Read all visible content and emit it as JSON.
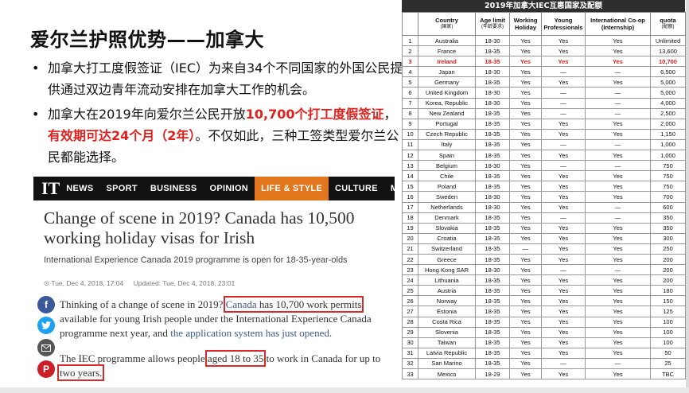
{
  "slide": {
    "title": "爱尔兰护照优势——加拿大",
    "bullet1": "加拿大打工度假签证（IEC）为来自34个不同国家的外国公民提供通过双边青年流动安排在加拿大工作的机会。",
    "bullet2_a": "加拿大在2019年向爱尔兰公民开放",
    "bullet2_b": "10,700个打工度假签证",
    "bullet2_c": "，",
    "bullet2_d": "有效期可达24个月（2年）",
    "bullet2_e": "。不仅如此，三种工签类型爱尔兰公民都能选择。"
  },
  "article": {
    "logo": "IT",
    "nav": [
      "NEWS",
      "SPORT",
      "BUSINESS",
      "OPINION",
      "LIFE & STYLE",
      "CULTURE",
      "MORE"
    ],
    "active_nav": "LIFE & STYLE",
    "headline": "Change of scene in 2019? Canada has 10,500 working holiday visas for Irish",
    "standfirst": "International Experience Canada 2019 programme is open for 18-35-year-olds",
    "date1": "⊙ Tue, Dec 4, 2018, 17:04",
    "date2": "Updated: Tue, Dec 4, 2018, 23:01",
    "p1_a": "Thinking of a change of scene in 2019? ",
    "p1_link": "Canada",
    "p1_b": " has 10,700 work permits",
    "p1_c": " available for young Irish people under the International Experience Canada programme next year, and ",
    "p1_link2": "the application system has just opened",
    "p1_d": ".",
    "p2_a": "The IEC programme allows people ",
    "p2_hl": "aged 18 to 35",
    "p2_b": " to work in Canada for up to ",
    "p2_hl2": "two years.",
    "social_icons": [
      "facebook-icon",
      "twitter-icon",
      "email-icon",
      "pinterest-icon"
    ]
  },
  "table": {
    "title": "2019年加拿大IEC互惠国家及配额",
    "headers": [
      {
        "main": "",
        "sub": ""
      },
      {
        "main": "Country",
        "sub": "(国家)"
      },
      {
        "main": "Age limit",
        "sub": "(年龄要求)"
      },
      {
        "main": "Working Holiday",
        "sub": ""
      },
      {
        "main": "Young Professionals",
        "sub": ""
      },
      {
        "main": "International Co-op (Internship)",
        "sub": ""
      },
      {
        "main": "quota",
        "sub": "(配额)"
      }
    ],
    "rows": [
      [
        "1",
        "Australia",
        "18-30",
        "Yes",
        "Yes",
        "Yes",
        "Unlimited"
      ],
      [
        "2",
        "France",
        "18-35",
        "Yes",
        "Yes",
        "Yes",
        "13,600"
      ],
      [
        "3",
        "Ireland",
        "18-35",
        "Yes",
        "Yes",
        "Yes",
        "10,700"
      ],
      [
        "4",
        "Japan",
        "18-30",
        "Yes",
        "—",
        "—",
        "6,500"
      ],
      [
        "5",
        "Germany",
        "18-35",
        "Yes",
        "Yes",
        "Yes",
        "5,000"
      ],
      [
        "6",
        "United Kingdom",
        "18-30",
        "Yes",
        "—",
        "—",
        "5,000"
      ],
      [
        "7",
        "Korea, Republic",
        "18-30",
        "Yes",
        "—",
        "—",
        "4,000"
      ],
      [
        "8",
        "New Zealand",
        "18-35",
        "Yes",
        "—",
        "—",
        "2,500"
      ],
      [
        "9",
        "Portugal",
        "18-35",
        "Yes",
        "Yes",
        "Yes",
        "2,000"
      ],
      [
        "10",
        "Czech Republic",
        "18-35",
        "Yes",
        "Yes",
        "Yes",
        "1,150"
      ],
      [
        "11",
        "Italy",
        "18-35",
        "Yes",
        "—",
        "—",
        "1,000"
      ],
      [
        "12",
        "Spain",
        "18-35",
        "Yes",
        "Yes",
        "Yes",
        "1,000"
      ],
      [
        "13",
        "Belgium",
        "18-30",
        "Yes",
        "—",
        "—",
        "750"
      ],
      [
        "14",
        "Chile",
        "18-35",
        "Yes",
        "Yes",
        "Yes",
        "750"
      ],
      [
        "15",
        "Poland",
        "18-35",
        "Yes",
        "Yes",
        "Yes",
        "750"
      ],
      [
        "16",
        "Sweden",
        "18-30",
        "Yes",
        "Yes",
        "Yes",
        "700"
      ],
      [
        "17",
        "Netherlands",
        "18-30",
        "Yes",
        "Yes",
        "—",
        "600"
      ],
      [
        "18",
        "Denmark",
        "18-35",
        "Yes",
        "—",
        "—",
        "350"
      ],
      [
        "19",
        "Slovakia",
        "18-35",
        "Yes",
        "Yes",
        "Yes",
        "350"
      ],
      [
        "20",
        "Croatia",
        "18-35",
        "Yes",
        "Yes",
        "Yes",
        "300"
      ],
      [
        "21",
        "Switzerland",
        "18-35",
        "—",
        "Yes",
        "Yes",
        "250"
      ],
      [
        "22",
        "Greece",
        "18-35",
        "Yes",
        "Yes",
        "Yes",
        "200"
      ],
      [
        "23",
        "Hong Kong SAR",
        "18-30",
        "Yes",
        "—",
        "—",
        "200"
      ],
      [
        "24",
        "Lithuania",
        "18-35",
        "Yes",
        "Yes",
        "Yes",
        "200"
      ],
      [
        "25",
        "Austria",
        "18-35",
        "Yes",
        "Yes",
        "Yes",
        "180"
      ],
      [
        "26",
        "Norway",
        "18-35",
        "Yes",
        "Yes",
        "Yes",
        "150"
      ],
      [
        "27",
        "Estonia",
        "18-35",
        "Yes",
        "Yes",
        "Yes",
        "125"
      ],
      [
        "28",
        "Costa Rica",
        "18-35",
        "Yes",
        "Yes",
        "Yes",
        "100"
      ],
      [
        "29",
        "Slovenia",
        "18-35",
        "Yes",
        "Yes",
        "Yes",
        "100"
      ],
      [
        "30",
        "Taiwan",
        "18-35",
        "Yes",
        "Yes",
        "Yes",
        "100"
      ],
      [
        "31",
        "Latvia Republic",
        "18-35",
        "Yes",
        "Yes",
        "Yes",
        "50"
      ],
      [
        "32",
        "San Marino",
        "18-35",
        "Yes",
        "—",
        "—",
        "25"
      ],
      [
        "33",
        "Mexico",
        "18-29",
        "Yes",
        "Yes",
        "Yes",
        "TBC"
      ]
    ],
    "highlight_row": "3",
    "highlight_color": "#e0201c"
  }
}
